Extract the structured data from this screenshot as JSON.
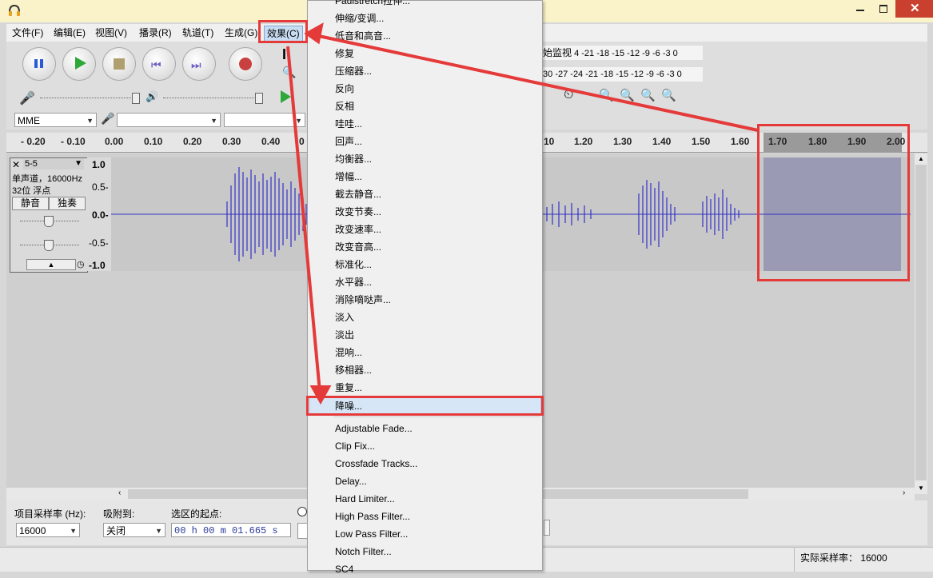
{
  "menubar": {
    "items": [
      "文件(F)",
      "编辑(E)",
      "视图(V)",
      "播录(R)",
      "轨道(T)",
      "生成(G)",
      "效果(C)"
    ]
  },
  "toolbar": {
    "audio_host": "MME",
    "meter_label": "始监视",
    "meter_ticks_top": [
      "4",
      "-21",
      "-18",
      "-15",
      "-12",
      "-9",
      "-6",
      "-3",
      "0"
    ],
    "meter_ticks_bottom": [
      "30",
      "-27",
      "-24",
      "-21",
      "-18",
      "-15",
      "-12",
      "-9",
      "-6",
      "-3",
      "0"
    ]
  },
  "ruler": {
    "ticks": [
      "- 0.20",
      "- 0.10",
      "0.00",
      "0.10",
      "0.20",
      "0.30",
      "0.40",
      "0",
      "10",
      "1.20",
      "1.30",
      "1.40",
      "1.50",
      "1.60",
      "1.70",
      "1.80",
      "1.90",
      "2.00"
    ]
  },
  "track": {
    "name": "5-5",
    "info_line1": "单声道，16000Hz",
    "info_line2": "32位 浮点",
    "mute_label": "静音",
    "solo_label": "独奏",
    "scale": [
      "1.0",
      "0.5-",
      "0.0-",
      "-0.5-",
      "-1.0"
    ]
  },
  "effects_menu": {
    "items": [
      "Paulstretch拉伸...",
      "伸缩/变调...",
      "低音和高音...",
      "修复",
      "压缩器...",
      "反向",
      "反相",
      "哇哇...",
      "回声...",
      "均衡器...",
      "增幅...",
      "截去静音...",
      "改变节奏...",
      "改变速率...",
      "改变音高...",
      "标准化...",
      "水平器...",
      "消除嘀哒声...",
      "淡入",
      "淡出",
      "混响...",
      "移相器...",
      "重复...",
      "降噪...",
      "Adjustable Fade...",
      "Clip Fix...",
      "Crossfade Tracks...",
      "Delay...",
      "Hard Limiter...",
      "High Pass Filter...",
      "Low Pass Filter...",
      "Notch Filter...",
      "SC4"
    ],
    "highlighted": "降噪..."
  },
  "bottom": {
    "rate_label": "项目采样率 (Hz):",
    "rate_value": "16000",
    "snap_label": "吸附到:",
    "snap_value": "关闭",
    "selstart_label": "选区的起点:",
    "selstart_value": "00 h 00 m 01.665 s"
  },
  "status": {
    "actual_rate": "实际采样率： 16000"
  },
  "colors": {
    "annotation_red": "#e53a3a",
    "waveform": "#3232c8",
    "selection": "#9a9ab4",
    "menu_highlight": "#d6e6f7"
  }
}
